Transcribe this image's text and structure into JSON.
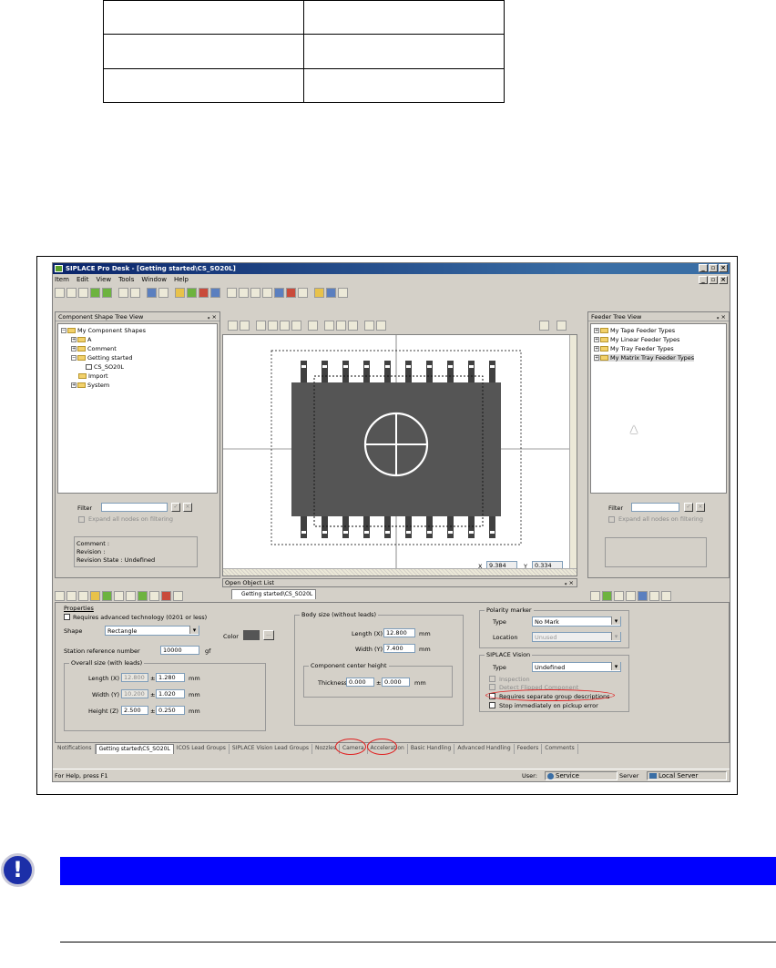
{
  "app": {
    "title": "SIPLACE Pro Desk - [Getting started\\CS_SO20L]",
    "menu": [
      "Item",
      "Edit",
      "View",
      "Tools",
      "Window",
      "Help"
    ]
  },
  "left_panel": {
    "title": "Component Shape Tree View",
    "tree": [
      {
        "label": "My Component Shapes",
        "level": 0
      },
      {
        "label": "A",
        "level": 1
      },
      {
        "label": "Comment",
        "level": 1
      },
      {
        "label": "Getting started",
        "level": 1
      },
      {
        "label": "CS_SO20L",
        "level": 2
      },
      {
        "label": "Import",
        "level": 1
      },
      {
        "label": "System",
        "level": 1
      }
    ],
    "filter_label": "Filter",
    "expand_label": "Expand all nodes on filtering",
    "info": [
      "Comment :",
      "Revision :",
      "Revision State : Undefined"
    ]
  },
  "right_panel": {
    "title": "Feeder Tree View",
    "tree": [
      "My Tape Feeder Types",
      "My Linear Feeder Types",
      "My Tray Feeder Types",
      "My Matrix Tray Feeder Types"
    ],
    "filter_label": "Filter",
    "expand_label": "Expand all nodes on filtering"
  },
  "canvas": {
    "x_label": "X",
    "x_value": "9.384",
    "y_label": "Y",
    "y_value": "0.334"
  },
  "open_object_list": {
    "title": "Open Object List",
    "tab": "Getting started\\CS_SO20L"
  },
  "properties": {
    "title": "Properties",
    "advanced": "Requires advanced technology (0201 or less)",
    "shape_label": "Shape",
    "shape_value": "Rectangle",
    "color_label": "Color",
    "station_label": "Station reference number",
    "station_value": "10000",
    "station_unit": "gf",
    "overall": {
      "title": "Overall size (with leads)",
      "length_label": "Length (X)",
      "length_value": "12.800",
      "length_tol": "1.280",
      "width_label": "Width (Y)",
      "width_value": "10.200",
      "width_tol": "1.020",
      "height_label": "Height (Z)",
      "height_value": "2.500",
      "height_tol": "0.250",
      "unit": "mm"
    },
    "body": {
      "title": "Body size (without leads)",
      "length_label": "Length (X)",
      "length_value": "12.800",
      "width_label": "Width (Y)",
      "width_value": "7.400",
      "center_title": "Component center height",
      "thickness_label": "Thickness",
      "thickness_value": "0.000",
      "thickness_tol": "0.000",
      "unit": "mm"
    },
    "polarity": {
      "title": "Polarity marker",
      "type_label": "Type",
      "type_value": "No Mark",
      "location_label": "Location",
      "location_value": "Unused"
    },
    "vision": {
      "title": "SIPLACE Vision",
      "type_label": "Type",
      "type_value": "Undefined",
      "opt1": "Inspection",
      "opt2": "Detect Flipped Component",
      "opt3": "Requires separate group descriptions",
      "opt4": "Stop immediately on pickup error"
    }
  },
  "tabs": [
    "Notifications",
    "Getting started\\CS_SO20L",
    "ICOS Lead Groups",
    "SIPLACE Vision Lead Groups",
    "Nozzles",
    "Camera",
    "Acceleration",
    "Basic Handling",
    "Advanced Handling",
    "Feeders",
    "Comments"
  ],
  "status": {
    "help": "For Help, press F1",
    "user_label": "User:",
    "user_value": "Service",
    "server_label": "Server",
    "server_value": "Local Server"
  },
  "note_icon": "exclamation-icon",
  "colors": {
    "note_bar": "#0000ff",
    "note_icon": "#1c2fa8",
    "highlight_oval": "#e02020",
    "title_bar": "#0a246a"
  }
}
